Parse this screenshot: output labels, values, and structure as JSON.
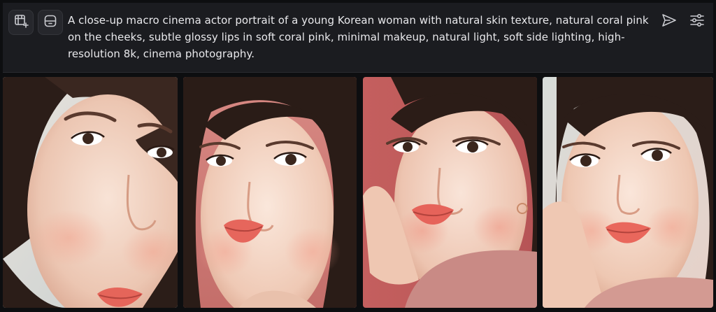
{
  "toolbar": {
    "left_buttons": [
      {
        "name": "video-add-button",
        "icon": "film-plus-icon"
      },
      {
        "name": "image-ref-button",
        "icon": "image-frame-icon"
      }
    ],
    "right_buttons": [
      {
        "name": "send-button",
        "icon": "send-icon"
      },
      {
        "name": "settings-button",
        "icon": "sliders-icon"
      }
    ]
  },
  "prompt": {
    "text": "A close-up macro cinema actor portrait of a young Korean woman with natural skin texture, natural coral pink on the cheeks, subtle glossy lips in soft coral pink, minimal makeup, natural light, soft side lighting, high-resolution 8k, cinema photography."
  },
  "colors": {
    "background": "#0d0e10",
    "bar": "#1b1c20",
    "text": "#e9e9ec",
    "icon": "#c9cacf"
  },
  "gallery": {
    "images": [
      {
        "name": "result-image-1"
      },
      {
        "name": "result-image-2"
      },
      {
        "name": "result-image-3"
      },
      {
        "name": "result-image-4"
      }
    ]
  }
}
